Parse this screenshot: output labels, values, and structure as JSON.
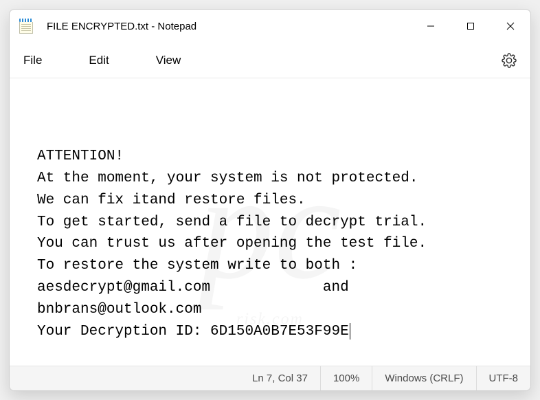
{
  "titlebar": {
    "title": "FILE ENCRYPTED.txt - Notepad"
  },
  "menubar": {
    "file": "File",
    "edit": "Edit",
    "view": "View"
  },
  "content": {
    "lines": [
      "ATTENTION!",
      "At the moment, your system is not protected.",
      "We can fix itand restore files.",
      "To get started, send a file to decrypt trial.",
      "You can trust us after opening the test file.",
      "To restore the system write to both :",
      "aesdecrypt@gmail.com             and",
      "bnbrans@outlook.com",
      "Your Decryption ID: 6D150A0B7E53F99E"
    ]
  },
  "statusbar": {
    "position": "Ln 7, Col 37",
    "zoom": "100%",
    "line_ending": "Windows (CRLF)",
    "encoding": "UTF-8"
  }
}
